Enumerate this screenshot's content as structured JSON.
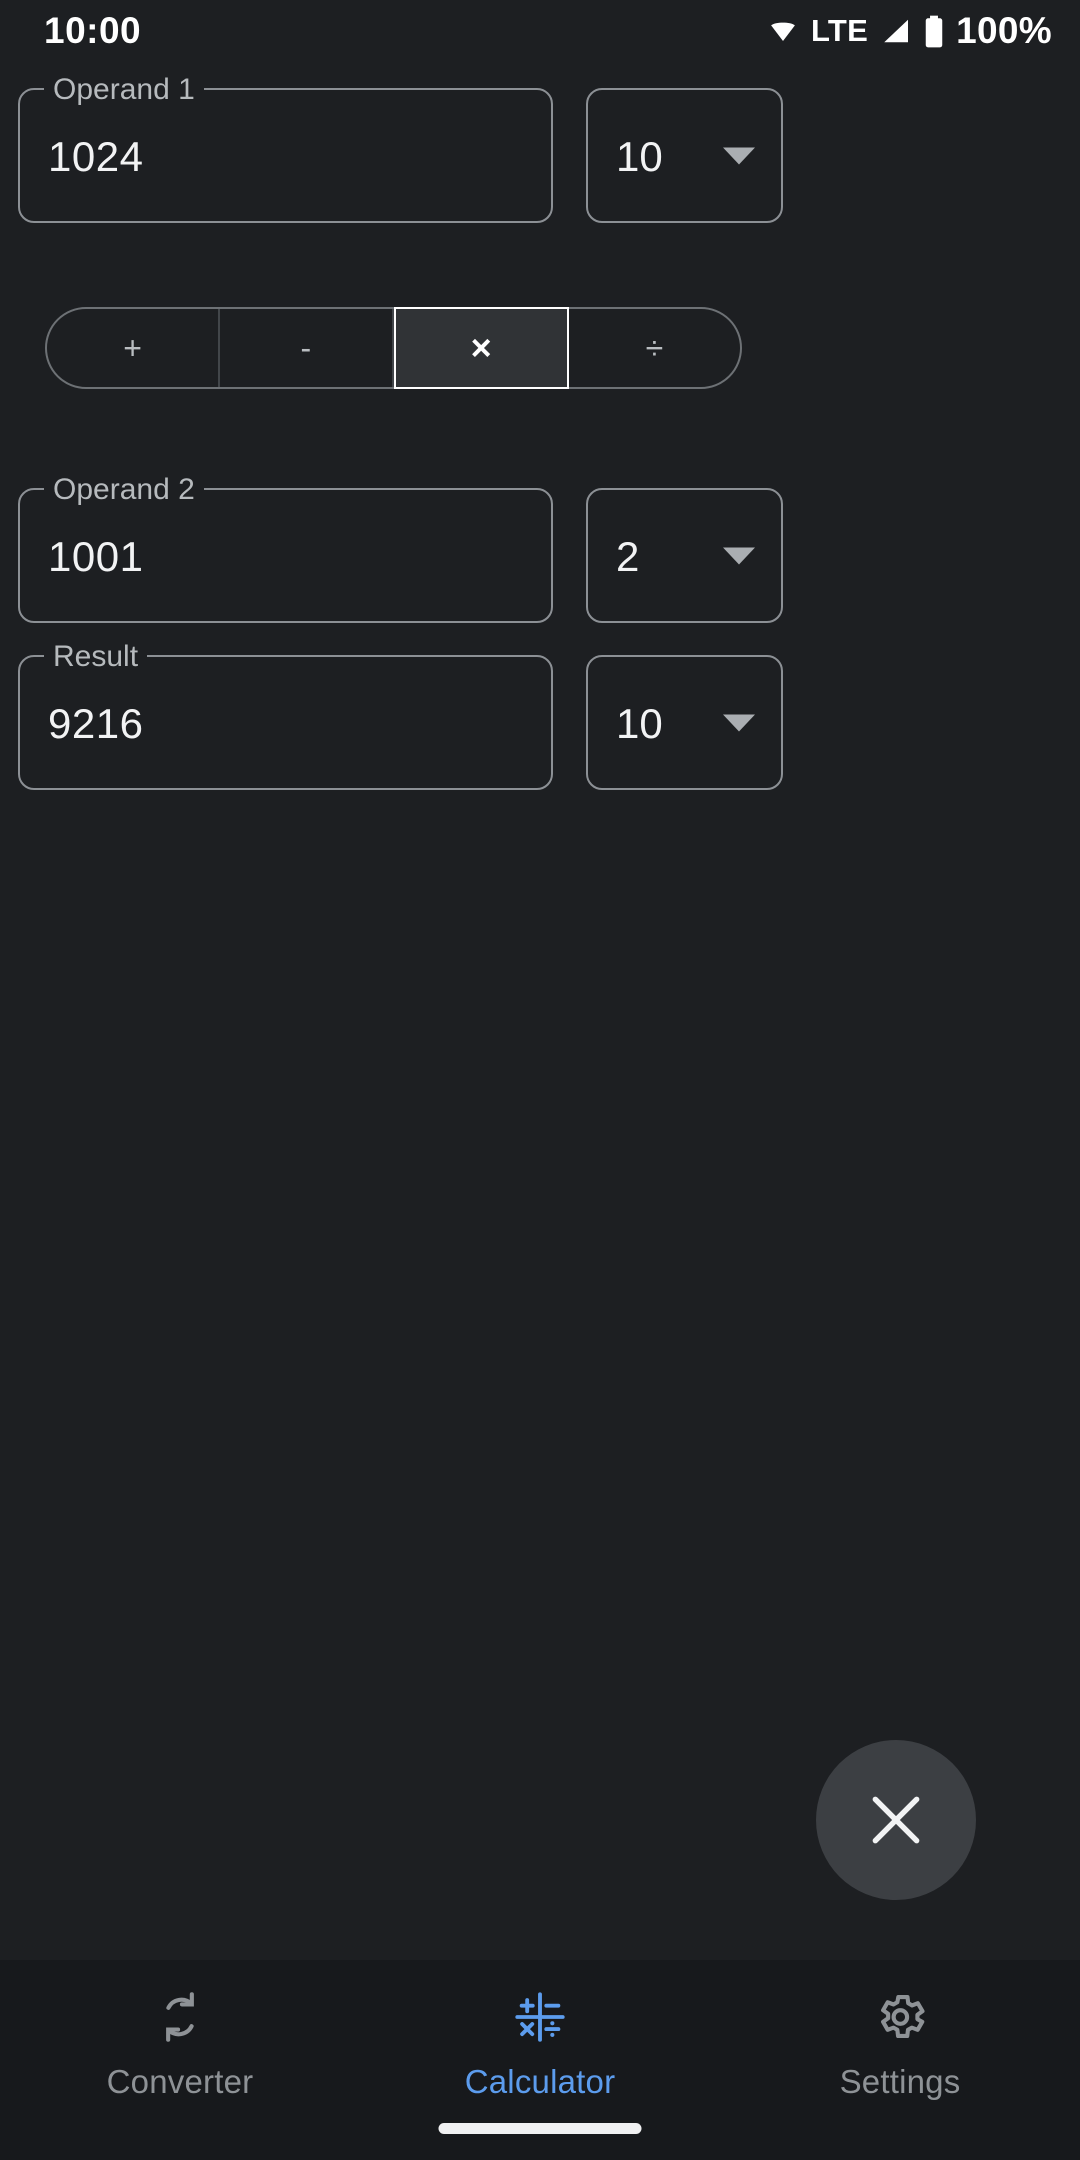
{
  "statusbar": {
    "time": "10:00",
    "network": "LTE",
    "battery": "100%",
    "icons": [
      "wifi-icon",
      "signal-icon",
      "battery-icon"
    ]
  },
  "colors": {
    "background": "#1d1f22",
    "nav_background": "#17191c",
    "field_border": "#8c9095",
    "label": "#b6babd",
    "value": "#f2f3f4",
    "accent": "#5c9ced",
    "selected_segment_bg": "#303336",
    "selected_segment_border": "#ffffff",
    "fab_bg": "#3c3f43",
    "inactive_nav": "#8e9296"
  },
  "calculator": {
    "operand1": {
      "label": "Operand 1",
      "value": "1024",
      "placeholder": "Operand 1",
      "base": "10"
    },
    "operand2": {
      "label": "Operand 2",
      "value": "1001",
      "placeholder": "Operand 2",
      "base": "2"
    },
    "result": {
      "label": "Result",
      "value": "9216",
      "placeholder": "Result",
      "base": "10"
    },
    "operators": [
      {
        "symbol": "+",
        "name": "add",
        "selected": false
      },
      {
        "symbol": "-",
        "name": "subtract",
        "selected": false
      },
      {
        "symbol": "×",
        "name": "multiply",
        "selected": true
      },
      {
        "symbol": "÷",
        "name": "divide",
        "selected": false
      }
    ],
    "selected_operator": "×",
    "clear_button": {
      "icon": "close-icon",
      "label": "Clear"
    }
  },
  "bottomnav": {
    "items": [
      {
        "label": "Converter",
        "icon": "sync-icon",
        "active": false
      },
      {
        "label": "Calculator",
        "icon": "calculator-icon",
        "active": true
      },
      {
        "label": "Settings",
        "icon": "gear-icon",
        "active": false
      }
    ]
  }
}
